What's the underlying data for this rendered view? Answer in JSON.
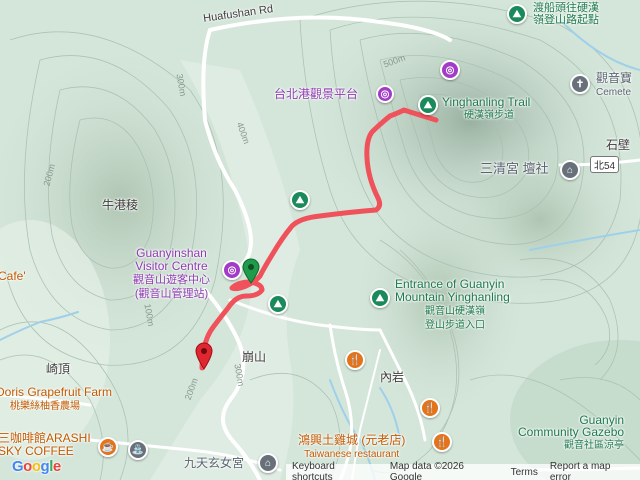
{
  "roads": {
    "huafushan": "Huafushan Rd",
    "north54": "北54"
  },
  "places": {
    "niugangleng": "牛港稜",
    "bengshan": "崩山",
    "neiyan": "內岩",
    "qiding": "崎頂",
    "cafe": "Cafe'",
    "shibi": "石壁"
  },
  "pois": {
    "ferry_top": {
      "line1": "渡船頭往硬漢",
      "line2": "嶺登山路起點",
      "icon": "trail-icon"
    },
    "guanyin_cemetery": {
      "line1": "觀音寶",
      "line2": "Cemete",
      "icon": "cemetery-icon"
    },
    "taipei_port_platform": {
      "text": "台北港觀景平台",
      "icon": "camera-icon"
    },
    "yinghanling_trail": {
      "en": "Yinghanling Trail",
      "zh": "硬漢嶺步道",
      "icon": "trail-icon"
    },
    "sanqing_temple": {
      "text": "三清宮 壇社",
      "icon": "temple-icon"
    },
    "visitor_centre": {
      "en1": "Guanyinshan",
      "en2": "Visitor Centre",
      "zh1": "觀音山遊客中心",
      "zh2": "(觀音山管理站)",
      "icon": "camera-icon"
    },
    "entrance": {
      "en1": "Entrance of Guanyin",
      "en2": "Mountain Yinghanling",
      "zh1": "觀音山硬漢嶺",
      "zh2": "登山步道入口",
      "icon": "trail-icon"
    },
    "doris": {
      "en": "Doris Grapefruit Farm",
      "zh": "桃樂絲柚香農場"
    },
    "arashi": {
      "line1": "三咖啡館ARASHI",
      "line2": "SKY COFFEE",
      "icon": "coffee-icon"
    },
    "hongxing": {
      "zh": "鴻興土雞城 (元老店)",
      "en": "Taiwanese restaurant",
      "icon": "fork-knife-icon"
    },
    "jiutian": {
      "text": "九天玄女宮",
      "icon": "temple-icon"
    },
    "gazebo": {
      "line1": "Guanyin",
      "line2": "Community Gazebo",
      "line3": "觀音社區涼亭"
    }
  },
  "elevations": [
    "500m",
    "400m",
    "300m",
    "200m",
    "100m",
    "300m",
    "200m"
  ],
  "attribution": {
    "logo": "Google",
    "keyboard": "Keyboard shortcuts",
    "mapdata": "Map data ©2026 Google",
    "terms": "Terms",
    "report": "Report a map error"
  },
  "colors": {
    "route": "#f0525b",
    "trail_green": "#1b8a5a",
    "purple": "#a23cc7",
    "orange": "#e3741c"
  }
}
